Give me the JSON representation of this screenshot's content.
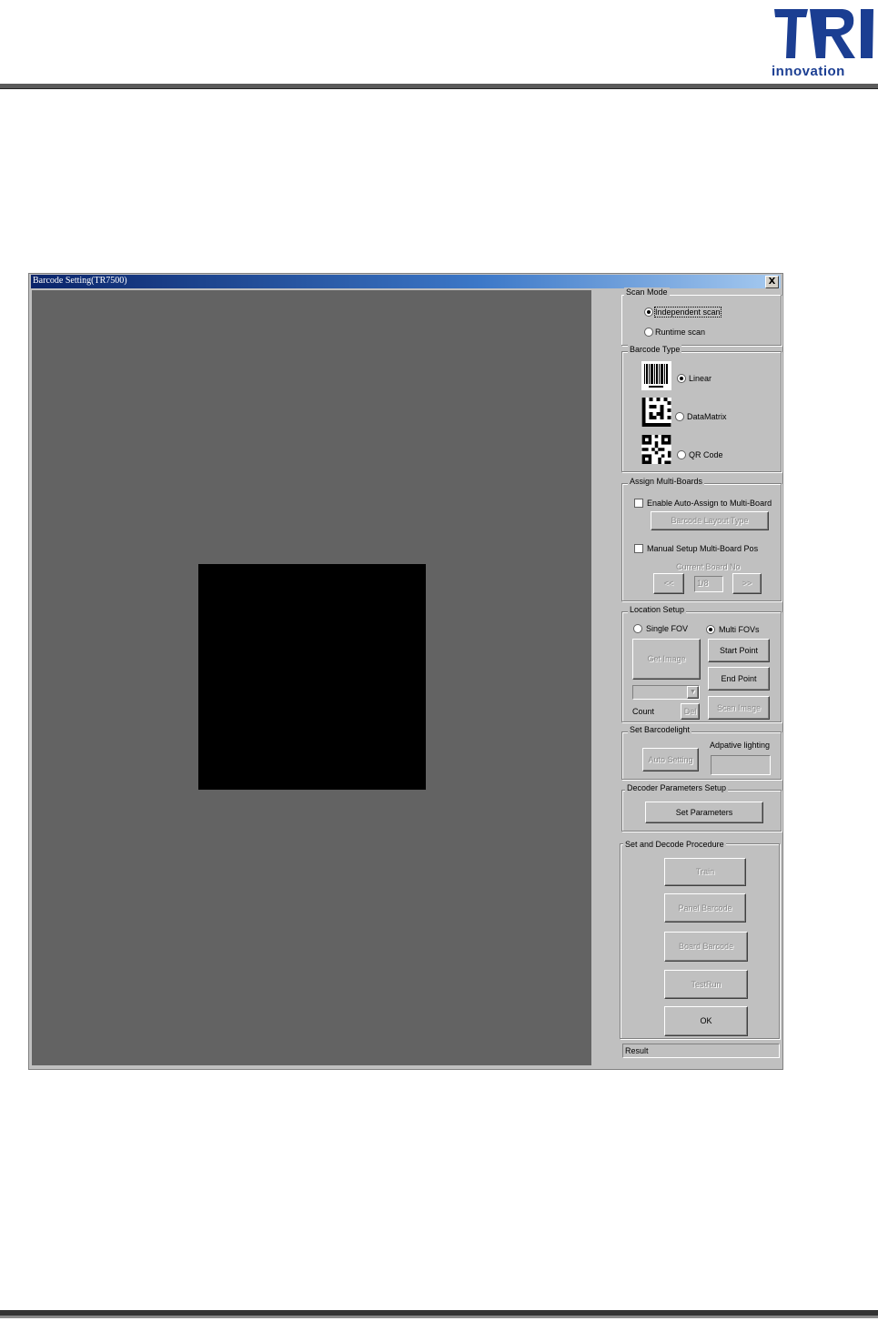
{
  "logo": {
    "letters": "TRI",
    "wordmark": "innovation",
    "brand_color": "#1b3e92"
  },
  "window": {
    "title": "Barcode Setting(TR7500)",
    "close_label": "X"
  },
  "scan_mode": {
    "legend": "Scan Mode",
    "options": [
      {
        "label": "Independent scan",
        "selected": true
      },
      {
        "label": "Runtime scan",
        "selected": false
      }
    ]
  },
  "barcode_type": {
    "legend": "Barcode Type",
    "options": [
      {
        "label": "Linear",
        "selected": true,
        "icon": "linear-barcode-icon"
      },
      {
        "label": "DataMatrix",
        "selected": false,
        "icon": "datamatrix-icon"
      },
      {
        "label": "QR Code",
        "selected": false,
        "icon": "qr-code-icon"
      }
    ]
  },
  "multi_boards": {
    "legend": "Assign Multi-Boards",
    "auto_assign_label": "Enable Auto-Assign to Multi-Board",
    "layout_type_button": "Barcode Layout Type",
    "manual_setup_label": "Manual Setup Multi-Board Pos",
    "current_board_label": "Current Board No",
    "prev_button": "<<",
    "board_value": "1/8",
    "next_button": ">>"
  },
  "location_setup": {
    "legend": "Location Setup",
    "single_fov": "Single FOV",
    "multi_fovs": "Multi FOVs",
    "single_selected": false,
    "multi_selected": true,
    "get_image_button": "Get Image",
    "start_point_button": "Start Point",
    "end_point_button": "End Point",
    "count_label": "Count",
    "del_button": "Del",
    "scan_image_button": "Scan Image"
  },
  "barcode_light": {
    "legend": "Set Barcodelight",
    "adaptive_label": "Adpative lighting",
    "auto_setting_button": "Auto Setting"
  },
  "decoder": {
    "legend": "Decoder Parameters Setup",
    "set_parameters_button": "Set Parameters"
  },
  "procedure": {
    "legend": "Set and Decode Procedure",
    "train_button": "Train",
    "panel_barcode_button": "Panel Barcode",
    "board_barcode_button": "Board Barcode",
    "testrun_button": "TestRun",
    "ok_button": "OK"
  },
  "result": {
    "label": "Result"
  }
}
